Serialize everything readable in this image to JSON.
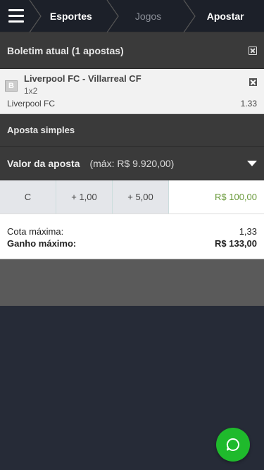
{
  "nav": {
    "crumbs": [
      "Esportes",
      "Jogos",
      "Apostar"
    ]
  },
  "betslip": {
    "title": "Boletim atual (1 apostas)",
    "bet": {
      "badge": "B",
      "match": "Liverpool FC - Villarreal CF",
      "market": "1x2",
      "selection": "Liverpool FC",
      "odds": "1.33"
    },
    "mode": "Aposta simples",
    "stake_label": "Valor da aposta",
    "stake_max": "(máx: R$ 9.920,00)",
    "quick_buttons": [
      "C",
      "+ 1,00",
      "+ 5,00"
    ],
    "amount": "R$ 100,00",
    "summary": {
      "odds_label": "Cota máxima:",
      "odds_value": "1,33",
      "win_label": "Ganho máximo:",
      "win_value": "R$ 133,00"
    }
  },
  "colors": {
    "accent": "#1fba2c",
    "amount": "#6a9a3b",
    "topbar": "#1c2029",
    "background": "#262b37"
  },
  "icons": {
    "menu": "hamburger-icon",
    "clear": "close-box-icon",
    "chat": "chat-icon"
  }
}
